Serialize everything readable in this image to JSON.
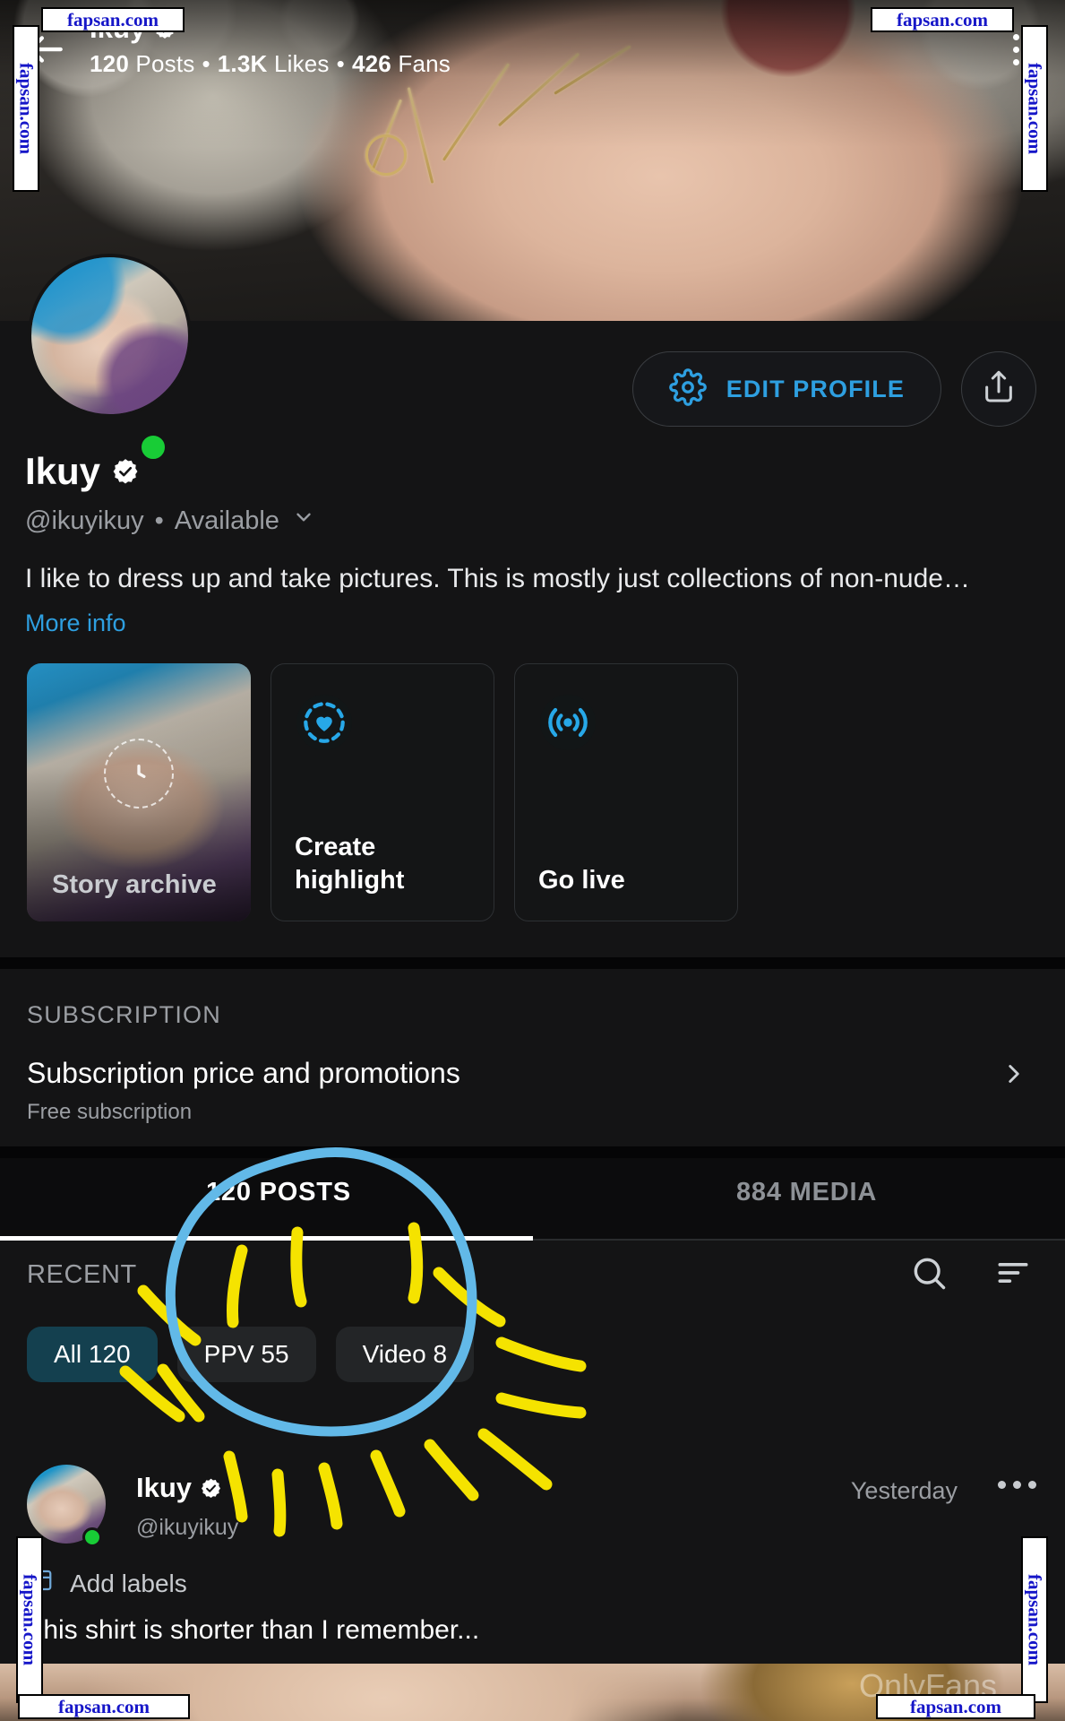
{
  "topbar": {
    "back_icon": "back-arrow-icon",
    "kebab_icon": "more-vertical-icon",
    "name": "Ikuy",
    "verified_icon": "verified-badge-icon",
    "stats": {
      "posts_value": "120",
      "posts_label": "Posts",
      "likes_value": "1.3K",
      "likes_label": "Likes",
      "fans_value": "426",
      "fans_label": "Fans",
      "separator": "•"
    }
  },
  "profile": {
    "avatar_name": "profile-avatar",
    "online_status": "online",
    "display_name": "Ikuy",
    "verified_icon": "verified-badge-icon",
    "handle": "@ikuyikuy",
    "separator": "•",
    "availability": "Available",
    "availability_chevron": "chevron-down-icon",
    "bio": "I like to dress up and take pictures. This is mostly just collections of non-nude…",
    "more_info": "More info",
    "edit_profile_label": "EDIT PROFILE",
    "edit_profile_icon": "gear-icon",
    "share_icon": "share-icon"
  },
  "cards": [
    {
      "label": "Story archive",
      "icon": "story-clock-icon",
      "name": "story-archive-card"
    },
    {
      "label": "Create\nhighlight",
      "line1": "Create",
      "line2": "highlight",
      "icon": "heart-circle-icon",
      "name": "create-highlight-card"
    },
    {
      "label": "Go live",
      "icon": "broadcast-icon",
      "name": "go-live-card"
    }
  ],
  "subscription": {
    "section_title": "SUBSCRIPTION",
    "row_title": "Subscription price and promotions",
    "row_subtitle": "Free subscription",
    "chevron_icon": "chevron-right-icon"
  },
  "tabs": [
    {
      "label": "120 POSTS",
      "active": true
    },
    {
      "label": "884 MEDIA",
      "active": false
    }
  ],
  "feed_toolbar": {
    "recent_label": "RECENT",
    "search_icon": "search-icon",
    "sort_icon": "sort-icon",
    "chips": [
      {
        "label": "All 120",
        "active": true
      },
      {
        "label": "PPV 55",
        "active": false
      },
      {
        "label": "Video 8",
        "active": false
      }
    ]
  },
  "post": {
    "author": "Ikuy",
    "verified_icon": "verified-badge-icon",
    "handle": "@ikuyikuy",
    "timestamp": "Yesterday",
    "kebab_icon": "more-horizontal-icon",
    "add_labels": "Add labels",
    "add_labels_icon": "label-icon",
    "text": "This shirt is shorter than I remember...",
    "media_watermark": "OnlyFans"
  },
  "annotations": {
    "circle_color": "#62b9e8",
    "rays_color": "#f5e300",
    "circle_name": "blue-circle-highlight",
    "rays_name": "yellow-sunburst-highlight"
  },
  "watermarks": [
    {
      "text": "fapsan.com",
      "name": "watermark-top-left"
    },
    {
      "text": "fapsan.com",
      "name": "watermark-top-right"
    },
    {
      "text": "fapsan.com",
      "name": "watermark-left-vertical"
    },
    {
      "text": "fapsan.com",
      "name": "watermark-right-vertical"
    },
    {
      "text": "fapsan.com",
      "name": "watermark-bottom-left-vertical"
    },
    {
      "text": "fapsan.com",
      "name": "watermark-bottom-right-vertical"
    },
    {
      "text": "fapsan.com",
      "name": "watermark-bottom-left"
    },
    {
      "text": "fapsan.com",
      "name": "watermark-bottom-right"
    }
  ],
  "colors": {
    "accent_blue": "#2e9fe0",
    "chip_active_bg": "#14404f",
    "online_green": "#18cc36",
    "page_bg": "#141415"
  }
}
